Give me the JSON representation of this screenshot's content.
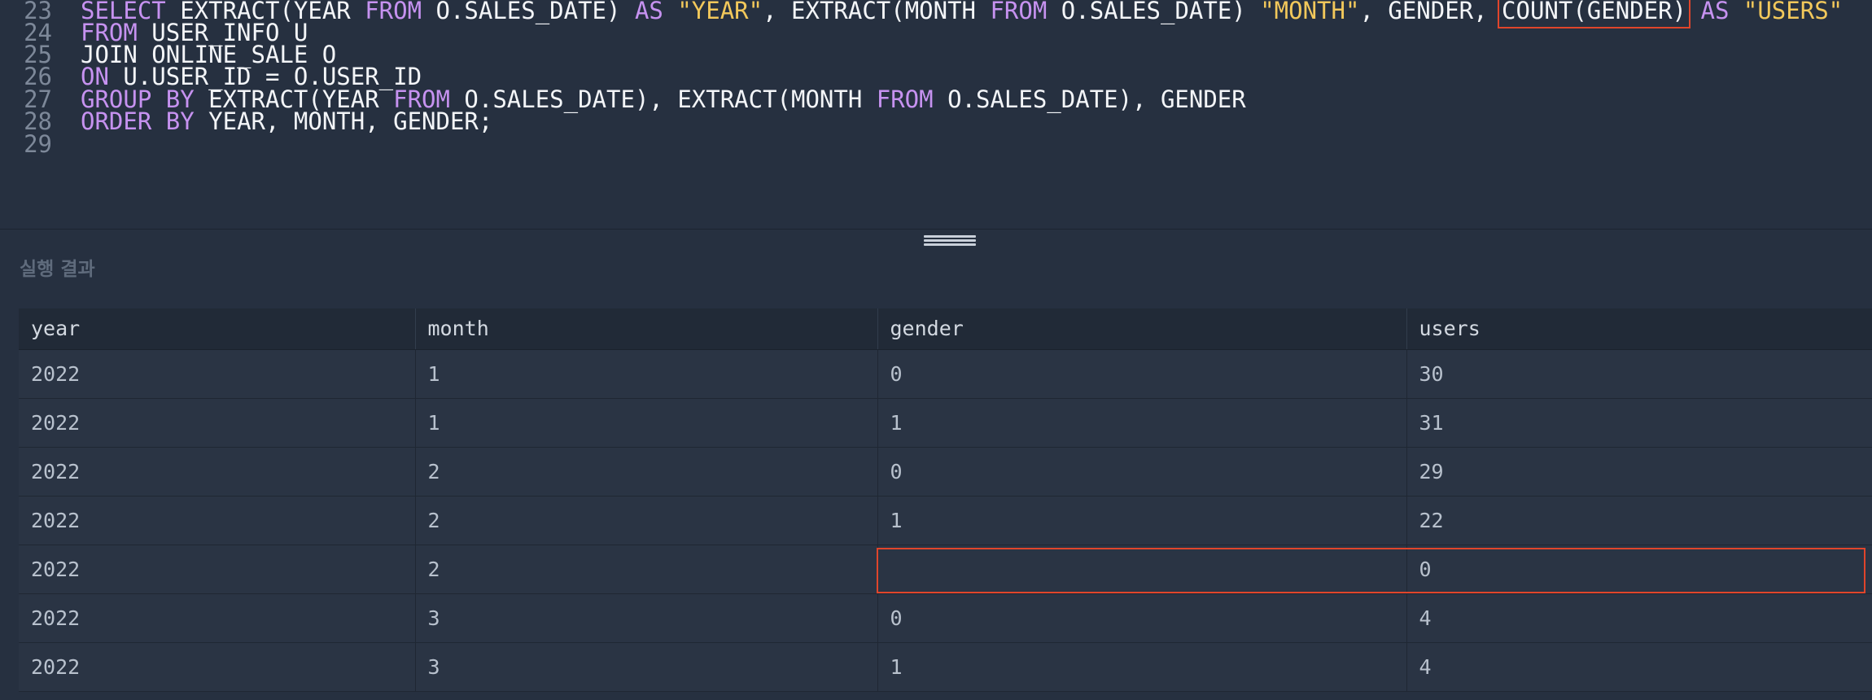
{
  "editor": {
    "lines": [
      {
        "number": "23",
        "tokens": [
          {
            "t": "SELECT",
            "c": "kw"
          },
          {
            "t": " EXTRACT(YEAR ",
            "c": "pl"
          },
          {
            "t": "FROM",
            "c": "kw"
          },
          {
            "t": " O.SALES_DATE) ",
            "c": "pl"
          },
          {
            "t": "AS",
            "c": "kw"
          },
          {
            "t": " ",
            "c": "pl"
          },
          {
            "t": "\"YEAR\"",
            "c": "str"
          },
          {
            "t": ", EXTRACT(MONTH ",
            "c": "pl"
          },
          {
            "t": "FROM",
            "c": "kw"
          },
          {
            "t": " O.SALES_DATE) ",
            "c": "pl"
          },
          {
            "t": "\"MONTH\"",
            "c": "str"
          },
          {
            "t": ", GENDER, ",
            "c": "pl"
          },
          {
            "t": "COUNT(GENDER)",
            "c": "pl",
            "highlight": true
          },
          {
            "t": " ",
            "c": "pl"
          },
          {
            "t": "AS",
            "c": "kw"
          },
          {
            "t": " ",
            "c": "pl"
          },
          {
            "t": "\"USERS\"",
            "c": "str"
          }
        ]
      },
      {
        "number": "24",
        "tokens": [
          {
            "t": "FROM",
            "c": "kw"
          },
          {
            "t": " USER_INFO U",
            "c": "pl"
          }
        ]
      },
      {
        "number": "25",
        "tokens": [
          {
            "t": "JOIN ONLINE_SALE O",
            "c": "pl"
          }
        ]
      },
      {
        "number": "26",
        "tokens": [
          {
            "t": "ON",
            "c": "kw"
          },
          {
            "t": " U.USER_ID = O.USER_ID",
            "c": "pl"
          }
        ]
      },
      {
        "number": "27",
        "tokens": [
          {
            "t": "GROUP BY",
            "c": "kw"
          },
          {
            "t": " EXTRACT(YEAR ",
            "c": "pl"
          },
          {
            "t": "FROM",
            "c": "kw"
          },
          {
            "t": " O.SALES_DATE), EXTRACT(MONTH ",
            "c": "pl"
          },
          {
            "t": "FROM",
            "c": "kw"
          },
          {
            "t": " O.SALES_DATE), GENDER",
            "c": "pl"
          }
        ]
      },
      {
        "number": "28",
        "tokens": [
          {
            "t": "ORDER BY",
            "c": "kw"
          },
          {
            "t": " YEAR, MONTH, GENDER;",
            "c": "pl"
          }
        ]
      },
      {
        "number": "29",
        "tokens": []
      }
    ]
  },
  "result": {
    "header": "실행 결과",
    "columns": [
      "year",
      "month",
      "gender",
      "users"
    ],
    "rows": [
      [
        "2022",
        "1",
        "0",
        "30"
      ],
      [
        "2022",
        "1",
        "1",
        "31"
      ],
      [
        "2022",
        "2",
        "0",
        "29"
      ],
      [
        "2022",
        "2",
        "1",
        "22"
      ],
      [
        "2022",
        "2",
        "",
        "0"
      ],
      [
        "2022",
        "3",
        "0",
        "4"
      ],
      [
        "2022",
        "3",
        "1",
        "4"
      ]
    ]
  },
  "colors": {
    "background": "#263040",
    "keyword": "#c692f0",
    "string": "#f2c85b",
    "highlight": "#e0452b"
  }
}
